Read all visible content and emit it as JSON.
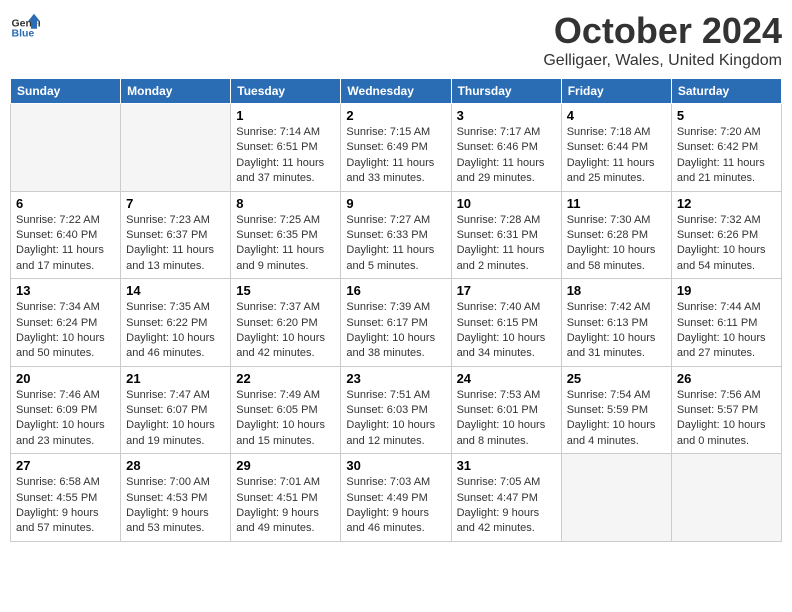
{
  "header": {
    "logo_general": "General",
    "logo_blue": "Blue",
    "month": "October 2024",
    "location": "Gelligaer, Wales, United Kingdom"
  },
  "days_of_week": [
    "Sunday",
    "Monday",
    "Tuesday",
    "Wednesday",
    "Thursday",
    "Friday",
    "Saturday"
  ],
  "weeks": [
    [
      {
        "day": "",
        "sunrise": "",
        "sunset": "",
        "daylight": "",
        "empty": true
      },
      {
        "day": "",
        "sunrise": "",
        "sunset": "",
        "daylight": "",
        "empty": true
      },
      {
        "day": "1",
        "sunrise": "Sunrise: 7:14 AM",
        "sunset": "Sunset: 6:51 PM",
        "daylight": "Daylight: 11 hours and 37 minutes."
      },
      {
        "day": "2",
        "sunrise": "Sunrise: 7:15 AM",
        "sunset": "Sunset: 6:49 PM",
        "daylight": "Daylight: 11 hours and 33 minutes."
      },
      {
        "day": "3",
        "sunrise": "Sunrise: 7:17 AM",
        "sunset": "Sunset: 6:46 PM",
        "daylight": "Daylight: 11 hours and 29 minutes."
      },
      {
        "day": "4",
        "sunrise": "Sunrise: 7:18 AM",
        "sunset": "Sunset: 6:44 PM",
        "daylight": "Daylight: 11 hours and 25 minutes."
      },
      {
        "day": "5",
        "sunrise": "Sunrise: 7:20 AM",
        "sunset": "Sunset: 6:42 PM",
        "daylight": "Daylight: 11 hours and 21 minutes."
      }
    ],
    [
      {
        "day": "6",
        "sunrise": "Sunrise: 7:22 AM",
        "sunset": "Sunset: 6:40 PM",
        "daylight": "Daylight: 11 hours and 17 minutes."
      },
      {
        "day": "7",
        "sunrise": "Sunrise: 7:23 AM",
        "sunset": "Sunset: 6:37 PM",
        "daylight": "Daylight: 11 hours and 13 minutes."
      },
      {
        "day": "8",
        "sunrise": "Sunrise: 7:25 AM",
        "sunset": "Sunset: 6:35 PM",
        "daylight": "Daylight: 11 hours and 9 minutes."
      },
      {
        "day": "9",
        "sunrise": "Sunrise: 7:27 AM",
        "sunset": "Sunset: 6:33 PM",
        "daylight": "Daylight: 11 hours and 5 minutes."
      },
      {
        "day": "10",
        "sunrise": "Sunrise: 7:28 AM",
        "sunset": "Sunset: 6:31 PM",
        "daylight": "Daylight: 11 hours and 2 minutes."
      },
      {
        "day": "11",
        "sunrise": "Sunrise: 7:30 AM",
        "sunset": "Sunset: 6:28 PM",
        "daylight": "Daylight: 10 hours and 58 minutes."
      },
      {
        "day": "12",
        "sunrise": "Sunrise: 7:32 AM",
        "sunset": "Sunset: 6:26 PM",
        "daylight": "Daylight: 10 hours and 54 minutes."
      }
    ],
    [
      {
        "day": "13",
        "sunrise": "Sunrise: 7:34 AM",
        "sunset": "Sunset: 6:24 PM",
        "daylight": "Daylight: 10 hours and 50 minutes."
      },
      {
        "day": "14",
        "sunrise": "Sunrise: 7:35 AM",
        "sunset": "Sunset: 6:22 PM",
        "daylight": "Daylight: 10 hours and 46 minutes."
      },
      {
        "day": "15",
        "sunrise": "Sunrise: 7:37 AM",
        "sunset": "Sunset: 6:20 PM",
        "daylight": "Daylight: 10 hours and 42 minutes."
      },
      {
        "day": "16",
        "sunrise": "Sunrise: 7:39 AM",
        "sunset": "Sunset: 6:17 PM",
        "daylight": "Daylight: 10 hours and 38 minutes."
      },
      {
        "day": "17",
        "sunrise": "Sunrise: 7:40 AM",
        "sunset": "Sunset: 6:15 PM",
        "daylight": "Daylight: 10 hours and 34 minutes."
      },
      {
        "day": "18",
        "sunrise": "Sunrise: 7:42 AM",
        "sunset": "Sunset: 6:13 PM",
        "daylight": "Daylight: 10 hours and 31 minutes."
      },
      {
        "day": "19",
        "sunrise": "Sunrise: 7:44 AM",
        "sunset": "Sunset: 6:11 PM",
        "daylight": "Daylight: 10 hours and 27 minutes."
      }
    ],
    [
      {
        "day": "20",
        "sunrise": "Sunrise: 7:46 AM",
        "sunset": "Sunset: 6:09 PM",
        "daylight": "Daylight: 10 hours and 23 minutes."
      },
      {
        "day": "21",
        "sunrise": "Sunrise: 7:47 AM",
        "sunset": "Sunset: 6:07 PM",
        "daylight": "Daylight: 10 hours and 19 minutes."
      },
      {
        "day": "22",
        "sunrise": "Sunrise: 7:49 AM",
        "sunset": "Sunset: 6:05 PM",
        "daylight": "Daylight: 10 hours and 15 minutes."
      },
      {
        "day": "23",
        "sunrise": "Sunrise: 7:51 AM",
        "sunset": "Sunset: 6:03 PM",
        "daylight": "Daylight: 10 hours and 12 minutes."
      },
      {
        "day": "24",
        "sunrise": "Sunrise: 7:53 AM",
        "sunset": "Sunset: 6:01 PM",
        "daylight": "Daylight: 10 hours and 8 minutes."
      },
      {
        "day": "25",
        "sunrise": "Sunrise: 7:54 AM",
        "sunset": "Sunset: 5:59 PM",
        "daylight": "Daylight: 10 hours and 4 minutes."
      },
      {
        "day": "26",
        "sunrise": "Sunrise: 7:56 AM",
        "sunset": "Sunset: 5:57 PM",
        "daylight": "Daylight: 10 hours and 0 minutes."
      }
    ],
    [
      {
        "day": "27",
        "sunrise": "Sunrise: 6:58 AM",
        "sunset": "Sunset: 4:55 PM",
        "daylight": "Daylight: 9 hours and 57 minutes."
      },
      {
        "day": "28",
        "sunrise": "Sunrise: 7:00 AM",
        "sunset": "Sunset: 4:53 PM",
        "daylight": "Daylight: 9 hours and 53 minutes."
      },
      {
        "day": "29",
        "sunrise": "Sunrise: 7:01 AM",
        "sunset": "Sunset: 4:51 PM",
        "daylight": "Daylight: 9 hours and 49 minutes."
      },
      {
        "day": "30",
        "sunrise": "Sunrise: 7:03 AM",
        "sunset": "Sunset: 4:49 PM",
        "daylight": "Daylight: 9 hours and 46 minutes."
      },
      {
        "day": "31",
        "sunrise": "Sunrise: 7:05 AM",
        "sunset": "Sunset: 4:47 PM",
        "daylight": "Daylight: 9 hours and 42 minutes."
      },
      {
        "day": "",
        "sunrise": "",
        "sunset": "",
        "daylight": "",
        "empty": true
      },
      {
        "day": "",
        "sunrise": "",
        "sunset": "",
        "daylight": "",
        "empty": true
      }
    ]
  ]
}
